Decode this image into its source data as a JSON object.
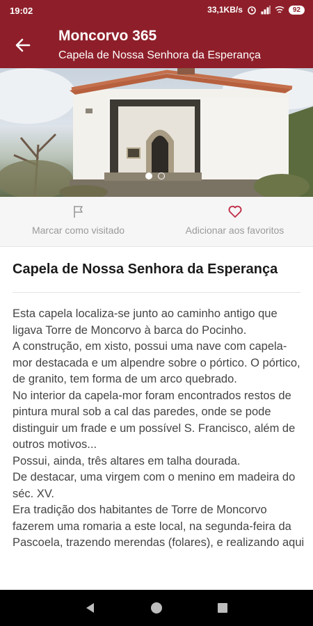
{
  "status_bar": {
    "time": "19:02",
    "network_speed": "33,1KB/s",
    "battery": "92"
  },
  "app_bar": {
    "title": "Moncorvo 365",
    "subtitle": "Capela de Nossa Senhora da Esperança",
    "background_color": "#8e1f2a"
  },
  "gallery": {
    "page_count": 2,
    "active_index": 0
  },
  "actions": {
    "visited_label": "Marcar como visitado",
    "favorites_label": "Adicionar aos favoritos",
    "favorites_icon_color": "#c0304a"
  },
  "article": {
    "title": "Capela de Nossa Senhora da Esperança",
    "paragraphs": [
      "Esta capela localiza-se junto ao caminho antigo que ligava Torre de Moncorvo à barca do Pocinho.",
      "A construção, em xisto, possui uma nave com capela-mor destacada e um alpendre sobre o pórtico. O pórtico, de granito, tem forma de um arco quebrado.",
      "No interior da capela-mor foram encontrados restos de pintura mural sob a cal das paredes, onde se pode distinguir um frade e um possível S. Francisco, além de outros motivos...",
      "Possui, ainda, três altares em talha dourada.",
      "De destacar, uma virgem com o menino em madeira do séc. XV.",
      "Era tradição dos habitantes de Torre de Moncorvo fazerem uma romaria a este local, na segunda-feira da Pascoela, trazendo merendas (folares), e realizando aqui"
    ]
  }
}
